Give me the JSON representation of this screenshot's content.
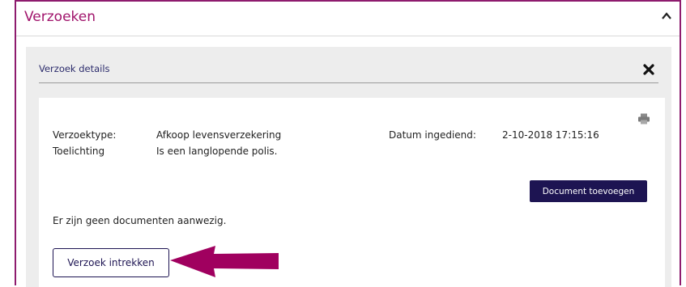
{
  "panel": {
    "title": "Verzoeken",
    "collapse_icon": "chevron-up-icon"
  },
  "details": {
    "title": "Verzoek details",
    "close_icon": "close-icon",
    "print_icon": "printer-icon",
    "fields": {
      "verzoektype_label": "Verzoektype:",
      "verzoektype_value": "Afkoop levensverzekering",
      "toelichting_label": "Toelichting",
      "toelichting_value": "Is een langlopende polis.",
      "datum_label": "Datum ingediend:",
      "datum_value": "2-10-2018 17:15:16"
    },
    "add_document_label": "Document toevoegen",
    "no_documents_text": "Er zijn geen documenten aanwezig.",
    "withdraw_label": "Verzoek intrekken"
  },
  "colors": {
    "accent": "#a0136b",
    "frame": "#8e1b6e",
    "primary_button": "#1d1452",
    "arrow": "#a0005f"
  }
}
